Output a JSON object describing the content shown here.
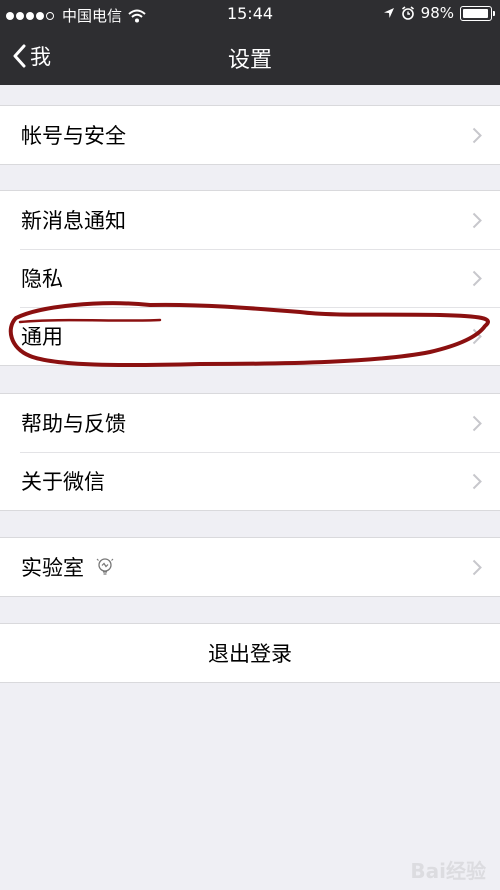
{
  "status_bar": {
    "carrier": "中国电信",
    "time": "15:44",
    "battery": "98%",
    "battery_level": 0.98
  },
  "nav": {
    "back_label": "我",
    "title": "设置"
  },
  "groups": [
    {
      "items": [
        {
          "label": "帐号与安全",
          "icon": "chevron-right-icon"
        }
      ]
    },
    {
      "items": [
        {
          "label": "新消息通知",
          "icon": "chevron-right-icon"
        },
        {
          "label": "隐私",
          "icon": "chevron-right-icon"
        },
        {
          "label": "通用",
          "icon": "chevron-right-icon"
        }
      ]
    },
    {
      "items": [
        {
          "label": "帮助与反馈",
          "icon": "chevron-right-icon"
        },
        {
          "label": "关于微信",
          "icon": "chevron-right-icon"
        }
      ]
    },
    {
      "items": [
        {
          "label": "实验室",
          "badge_icon": "lightbulb-icon",
          "icon": "chevron-right-icon"
        }
      ]
    }
  ],
  "logout": {
    "label": "退出登录"
  },
  "annotation": {
    "color": "#8b1010",
    "target": "通用"
  },
  "watermark": "Bai经验",
  "colors": {
    "header_bg": "#2e2e31",
    "page_bg": "#efeff4",
    "chevron": "#c7c7cc"
  }
}
